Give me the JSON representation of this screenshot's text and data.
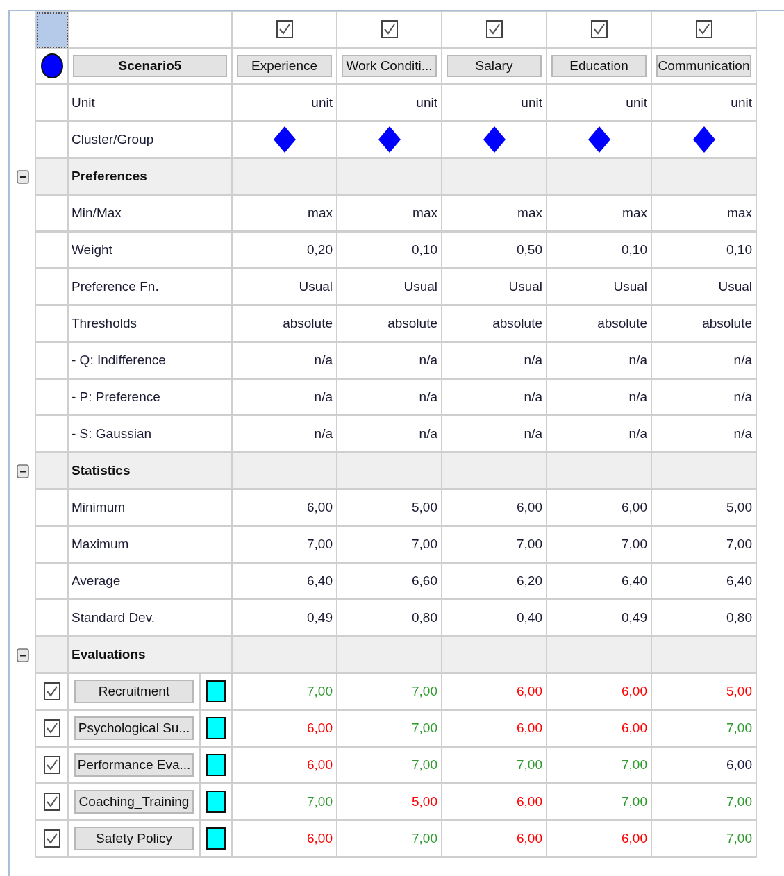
{
  "corner": {
    "selected": true
  },
  "scenario": {
    "name": "Scenario5",
    "color": "#0000ff"
  },
  "criteria": [
    {
      "name": "Experience",
      "checked": true
    },
    {
      "name": "Work Conditi...",
      "checked": true
    },
    {
      "name": "Salary",
      "checked": true
    },
    {
      "name": "Education",
      "checked": true
    },
    {
      "name": "Communication",
      "checked": true
    }
  ],
  "unit_row": {
    "label": "Unit",
    "values": [
      "unit",
      "unit",
      "unit",
      "unit",
      "unit"
    ]
  },
  "cluster_row": {
    "label": "Cluster/Group",
    "color": "#0000ff"
  },
  "sections": [
    {
      "title": "Preferences",
      "expanded": true,
      "rows": [
        {
          "kind": "text",
          "label": "Min/Max",
          "values": [
            "max",
            "max",
            "max",
            "max",
            "max"
          ]
        },
        {
          "kind": "text",
          "label": "Weight",
          "values": [
            "0,20",
            "0,10",
            "0,50",
            "0,10",
            "0,10"
          ]
        },
        {
          "kind": "text",
          "label": "Preference Fn.",
          "values": [
            "Usual",
            "Usual",
            "Usual",
            "Usual",
            "Usual"
          ]
        },
        {
          "kind": "text",
          "label": "Thresholds",
          "values": [
            "absolute",
            "absolute",
            "absolute",
            "absolute",
            "absolute"
          ]
        },
        {
          "kind": "text",
          "label": "- Q: Indifference",
          "values": [
            "n/a",
            "n/a",
            "n/a",
            "n/a",
            "n/a"
          ]
        },
        {
          "kind": "text",
          "label": "- P: Preference",
          "values": [
            "n/a",
            "n/a",
            "n/a",
            "n/a",
            "n/a"
          ]
        },
        {
          "kind": "text",
          "label": "- S: Gaussian",
          "values": [
            "n/a",
            "n/a",
            "n/a",
            "n/a",
            "n/a"
          ]
        }
      ]
    },
    {
      "title": "Statistics",
      "expanded": true,
      "rows": [
        {
          "kind": "text",
          "label": "Minimum",
          "values": [
            "6,00",
            "5,00",
            "6,00",
            "6,00",
            "5,00"
          ]
        },
        {
          "kind": "text",
          "label": "Maximum",
          "values": [
            "7,00",
            "7,00",
            "7,00",
            "7,00",
            "7,00"
          ]
        },
        {
          "kind": "text",
          "label": "Average",
          "values": [
            "6,40",
            "6,60",
            "6,20",
            "6,40",
            "6,40"
          ]
        },
        {
          "kind": "text",
          "label": "Standard Dev.",
          "values": [
            "0,49",
            "0,80",
            "0,40",
            "0,49",
            "0,80"
          ]
        }
      ]
    },
    {
      "title": "Evaluations",
      "expanded": true,
      "rows": [
        {
          "kind": "alternative",
          "name": "Recruitment",
          "checked": true,
          "color": "#00ffff",
          "values": [
            {
              "text": "7,00",
              "color": "#2e9a2e"
            },
            {
              "text": "7,00",
              "color": "#2e9a2e"
            },
            {
              "text": "6,00",
              "color": "#ff0000"
            },
            {
              "text": "6,00",
              "color": "#ff0000"
            },
            {
              "text": "5,00",
              "color": "#ff0000"
            }
          ]
        },
        {
          "kind": "alternative",
          "name": "Psychological Su...",
          "checked": true,
          "color": "#00ffff",
          "values": [
            {
              "text": "6,00",
              "color": "#ff0000"
            },
            {
              "text": "7,00",
              "color": "#2e9a2e"
            },
            {
              "text": "6,00",
              "color": "#ff0000"
            },
            {
              "text": "6,00",
              "color": "#ff0000"
            },
            {
              "text": "7,00",
              "color": "#2e9a2e"
            }
          ]
        },
        {
          "kind": "alternative",
          "name": "Performance Eva...",
          "checked": true,
          "color": "#00ffff",
          "values": [
            {
              "text": "6,00",
              "color": "#ff0000"
            },
            {
              "text": "7,00",
              "color": "#2e9a2e"
            },
            {
              "text": "7,00",
              "color": "#2e9a2e"
            },
            {
              "text": "7,00",
              "color": "#2e9a2e"
            },
            {
              "text": "6,00",
              "color": "#1a1a40"
            }
          ]
        },
        {
          "kind": "alternative",
          "name": "Coaching_Training",
          "checked": true,
          "color": "#00ffff",
          "values": [
            {
              "text": "7,00",
              "color": "#2e9a2e"
            },
            {
              "text": "5,00",
              "color": "#ff0000"
            },
            {
              "text": "6,00",
              "color": "#ff0000"
            },
            {
              "text": "7,00",
              "color": "#2e9a2e"
            },
            {
              "text": "7,00",
              "color": "#2e9a2e"
            }
          ]
        },
        {
          "kind": "alternative",
          "name": "Safety Policy",
          "checked": true,
          "color": "#00ffff",
          "values": [
            {
              "text": "6,00",
              "color": "#ff0000"
            },
            {
              "text": "7,00",
              "color": "#2e9a2e"
            },
            {
              "text": "6,00",
              "color": "#ff0000"
            },
            {
              "text": "6,00",
              "color": "#ff0000"
            },
            {
              "text": "7,00",
              "color": "#2e9a2e"
            }
          ]
        }
      ]
    }
  ]
}
